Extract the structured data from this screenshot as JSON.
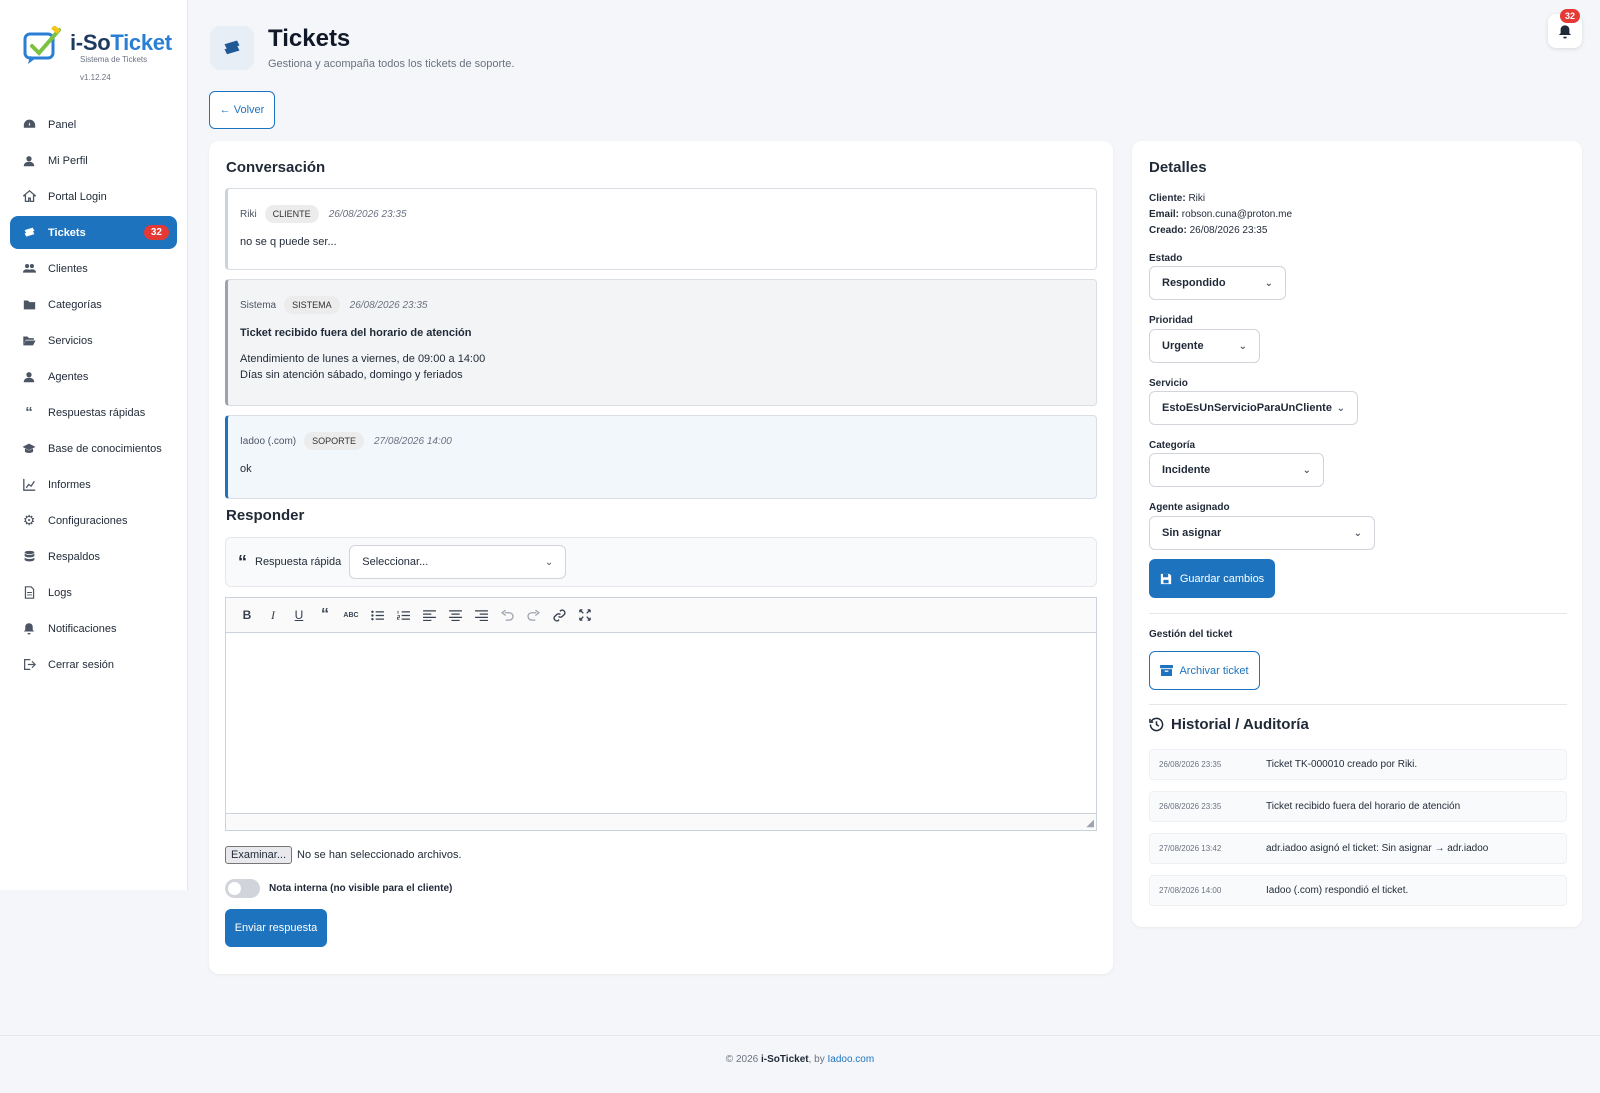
{
  "brand": {
    "name_prefix": "i-So",
    "name_suffix": "Ticket",
    "subtitle": "Sistema de Tickets",
    "version": "v1.12.24"
  },
  "sidebar": {
    "items": [
      {
        "label": "Panel",
        "icon": "dashboard-icon"
      },
      {
        "label": "Mi Perfil",
        "icon": "user-icon"
      },
      {
        "label": "Portal Login",
        "icon": "home-icon"
      },
      {
        "label": "Tickets",
        "icon": "tickets-icon",
        "badge": "32",
        "active": true
      },
      {
        "label": "Clientes",
        "icon": "clients-icon"
      },
      {
        "label": "Categorías",
        "icon": "folder-icon"
      },
      {
        "label": "Servicios",
        "icon": "folder-open-icon"
      },
      {
        "label": "Agentes",
        "icon": "agent-icon"
      },
      {
        "label": "Respuestas rápidas",
        "icon": "quote-icon"
      },
      {
        "label": "Base de conocimientos",
        "icon": "graduation-cap-icon"
      },
      {
        "label": "Informes",
        "icon": "chart-icon"
      },
      {
        "label": "Configuraciones",
        "icon": "gear-icon"
      },
      {
        "label": "Respaldos",
        "icon": "database-icon"
      },
      {
        "label": "Logs",
        "icon": "file-icon"
      },
      {
        "label": "Notificaciones",
        "icon": "bell-icon"
      },
      {
        "label": "Cerrar sesión",
        "icon": "logout-icon"
      }
    ]
  },
  "header": {
    "title": "Tickets",
    "subtitle": "Gestiona y acompaña todos los tickets de soporte.",
    "notifications_count": "32",
    "back_label": "← Volver"
  },
  "conversation": {
    "title": "Conversación",
    "messages": [
      {
        "author": "Riki",
        "tag": "CLIENTE",
        "date": "26/08/2026 23:35",
        "body": "no se q puede ser..."
      },
      {
        "author": "Sistema",
        "tag": "SISTEMA",
        "date": "26/08/2026 23:35",
        "heading": "Ticket recibido fuera del horario de atención",
        "line1": "Atendimiento de lunes a viernes, de 09:00 a 14:00",
        "line2": "Días sin atención sábado, domingo y feriados"
      },
      {
        "author": "Iadoo (.com)",
        "tag": "SOPORTE",
        "date": "27/08/2026 14:00",
        "body": "ok"
      }
    ]
  },
  "reply": {
    "title": "Responder",
    "quick_label": "Respuesta rápida",
    "quick_selected": "Seleccionar...",
    "file_button": "Examinar...",
    "file_status": "No se han seleccionado archivos.",
    "internal_note_label": "Nota interna (no visible para el cliente)",
    "send_label": "Enviar respuesta"
  },
  "details": {
    "title": "Detalles",
    "client_label": "Cliente:",
    "client_value": "Riki",
    "email_label": "Email:",
    "email_value": "robson.cuna@proton.me",
    "created_label": "Creado:",
    "created_value": "26/08/2026 23:35",
    "estado_label": "Estado",
    "estado_value": "Respondido",
    "prioridad_label": "Prioridad",
    "prioridad_value": "Urgente",
    "servicio_label": "Servicio",
    "servicio_value": "EstoEsUnServicioParaUnCliente",
    "categoria_label": "Categoría",
    "categoria_value": "Incidente",
    "agente_label": "Agente asignado",
    "agente_value": "Sin asignar",
    "save_label": "Guardar cambios",
    "gestion_label": "Gestión del ticket",
    "archive_label": "Archivar ticket"
  },
  "history": {
    "title": "Historial / Auditoría",
    "rows": [
      {
        "date": "26/08/2026 23:35",
        "text": "Ticket TK-000010 creado por Riki."
      },
      {
        "date": "26/08/2026 23:35",
        "text": "Ticket recibido fuera del horario de atención"
      },
      {
        "date": "27/08/2026 13:42",
        "text": "adr.iadoo asignó el ticket: Sin asignar → adr.iadoo"
      },
      {
        "date": "27/08/2026 14:00",
        "text": "Iadoo (.com) respondió el ticket."
      }
    ]
  },
  "footer": {
    "prefix": "© 2026",
    "brand": "i-SoTicket",
    "by": ", by",
    "link": "Iadoo.com"
  },
  "colors": {
    "primary": "#1e73be",
    "badge": "#e53935",
    "background": "#f4f6f9"
  }
}
